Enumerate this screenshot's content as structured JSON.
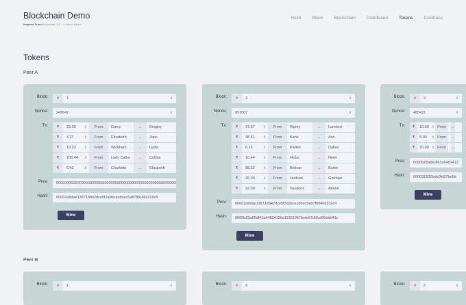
{
  "header": {
    "title": "Blockchain Demo",
    "subtitle_bold": "Inspired From",
    "subtitle": "Blockchain 101 - A Visual Demo"
  },
  "nav": [
    {
      "label": "Hash"
    },
    {
      "label": "Block"
    },
    {
      "label": "Blockchain"
    },
    {
      "label": "Distributed"
    },
    {
      "label": "Tokens",
      "active": true
    },
    {
      "label": "Coinbase"
    }
  ],
  "page_title": "Tokens",
  "labels": {
    "block": "Block:",
    "nonce": "Nonce:",
    "tx": "Tx:",
    "prev": "Prev:",
    "hash": "Hash:",
    "mine": "Mine",
    "hash_prefix": "#",
    "currency": "₹",
    "from": "From",
    "arrow": "→"
  },
  "peers": [
    {
      "name": "Peer A",
      "blocks": [
        {
          "block": "1",
          "nonce": "249647",
          "tx": [
            {
              "amount": "25.00",
              "from": "Darcy",
              "to": "Bingley"
            },
            {
              "amount": "4.27",
              "from": "Elizabeth",
              "to": "Jane"
            },
            {
              "amount": "19.22",
              "from": "Wickham",
              "to": "Lydia"
            },
            {
              "amount": "106.44",
              "from": "Lady Cathe",
              "to": "Collins"
            },
            {
              "amount": "6.42",
              "from": "Charlotte",
              "to": "Elizabeth"
            }
          ],
          "prev": "0000000000000000000000000000000000000000000000000000000000000000",
          "hash": "00002abdae138718842dce5f2a9bcacddec5a87f80469316c8"
        },
        {
          "block": "2",
          "nonce": "951007",
          "tx": [
            {
              "amount": "97.67",
              "from": "Ripley",
              "to": "Lambert"
            },
            {
              "amount": "48.61",
              "from": "Kane",
              "to": "Ash"
            },
            {
              "amount": "6.15",
              "from": "Parker",
              "to": "Dallas"
            },
            {
              "amount": "10.44",
              "from": "Hicks",
              "to": "Newt"
            },
            {
              "amount": "88.32",
              "from": "Bishop",
              "to": "Burke"
            },
            {
              "amount": "45.00",
              "from": "Hudson",
              "to": "Gorman"
            },
            {
              "amount": "92.00",
              "from": "Vasquez",
              "to": "Apone"
            }
          ],
          "prev": "00002abdae138718842dce5f2a9bcacddec5a87f80469316c8",
          "hash": "0000b25a66df41a64834130a11321057befe67d6fcd06ebb41c"
        },
        {
          "block": "3",
          "nonce": "485421",
          "tx": [
            {
              "amount": "10.00",
              "from": "",
              "to": ""
            },
            {
              "amount": "5.00",
              "from": "",
              "to": ""
            },
            {
              "amount": "20.00",
              "from": "",
              "to": ""
            }
          ],
          "prev": "0000b25a66df41a6483413",
          "hash": "000031832bde0fd07be6d"
        }
      ]
    },
    {
      "name": "Peer B",
      "blocks": [
        {
          "block": "1"
        },
        {
          "block": "2"
        },
        {
          "block": "3"
        }
      ]
    }
  ]
}
